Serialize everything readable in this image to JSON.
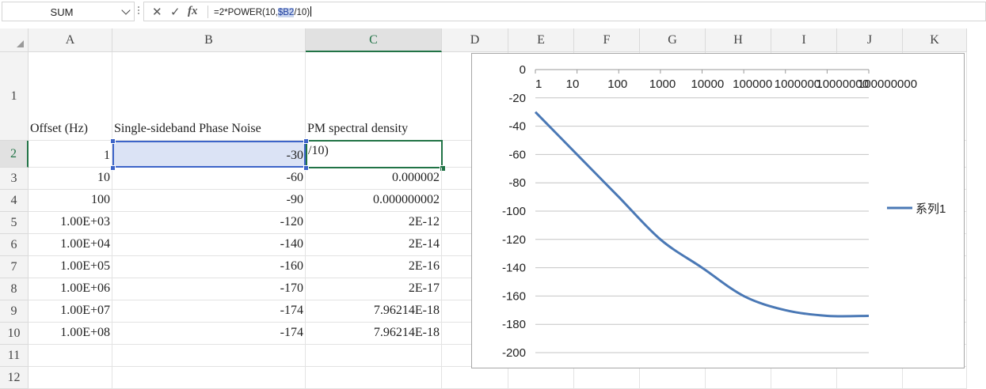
{
  "formula_bar": {
    "name_box": "SUM",
    "cancel_icon": "close-icon",
    "enter_icon": "checkmark-icon",
    "fx_label": "fx",
    "formula_prefix": "=2*POWER(10,",
    "formula_ref": "$B2",
    "formula_suffix": "/10)"
  },
  "columns": [
    "A",
    "B",
    "C",
    "D",
    "E",
    "F",
    "G",
    "H",
    "I",
    "J",
    "K"
  ],
  "rows": [
    "1",
    "2",
    "3",
    "4",
    "5",
    "6",
    "7",
    "8",
    "9",
    "10",
    "11",
    "12"
  ],
  "selected_column": "C",
  "selected_row": "2",
  "headers": {
    "a1": "Offset (Hz)",
    "b1": "Single-sideband Phase Noise",
    "c1": "PM spectral density"
  },
  "table": [
    {
      "a": "1",
      "b": "-30",
      "c": "/10)"
    },
    {
      "a": "10",
      "b": "-60",
      "c": "0.000002"
    },
    {
      "a": "100",
      "b": "-90",
      "c": "0.000000002"
    },
    {
      "a": "1.00E+03",
      "b": "-120",
      "c": "2E-12"
    },
    {
      "a": "1.00E+04",
      "b": "-140",
      "c": "2E-14"
    },
    {
      "a": "1.00E+05",
      "b": "-160",
      "c": "2E-16"
    },
    {
      "a": "1.00E+06",
      "b": "-170",
      "c": "2E-17"
    },
    {
      "a": "1.00E+07",
      "b": "-174",
      "c": "7.96214E-18"
    },
    {
      "a": "1.00E+08",
      "b": "-174",
      "c": "7.96214E-18"
    }
  ],
  "colors": {
    "accent_green": "#217346",
    "selection_blue": "#3c64c8",
    "series_line": "#4a78b5"
  },
  "chart_data": {
    "type": "line",
    "x_scale": "log",
    "x": [
      1,
      10,
      100,
      1000,
      10000,
      100000,
      1000000,
      10000000,
      100000000
    ],
    "x_tick_labels": [
      "1",
      "10",
      "100",
      "1000",
      "10000",
      "100000",
      "1000000",
      "10000000",
      "100000000"
    ],
    "y_tick_labels": [
      "0",
      "-20",
      "-40",
      "-60",
      "-80",
      "-100",
      "-120",
      "-140",
      "-160",
      "-180",
      "-200"
    ],
    "ylim": [
      -200,
      0
    ],
    "grid": true,
    "legend_position": "right",
    "series": [
      {
        "name": "系列1",
        "values": [
          -30,
          -60,
          -90,
          -120,
          -140,
          -160,
          -170,
          -174,
          -174
        ]
      }
    ]
  }
}
